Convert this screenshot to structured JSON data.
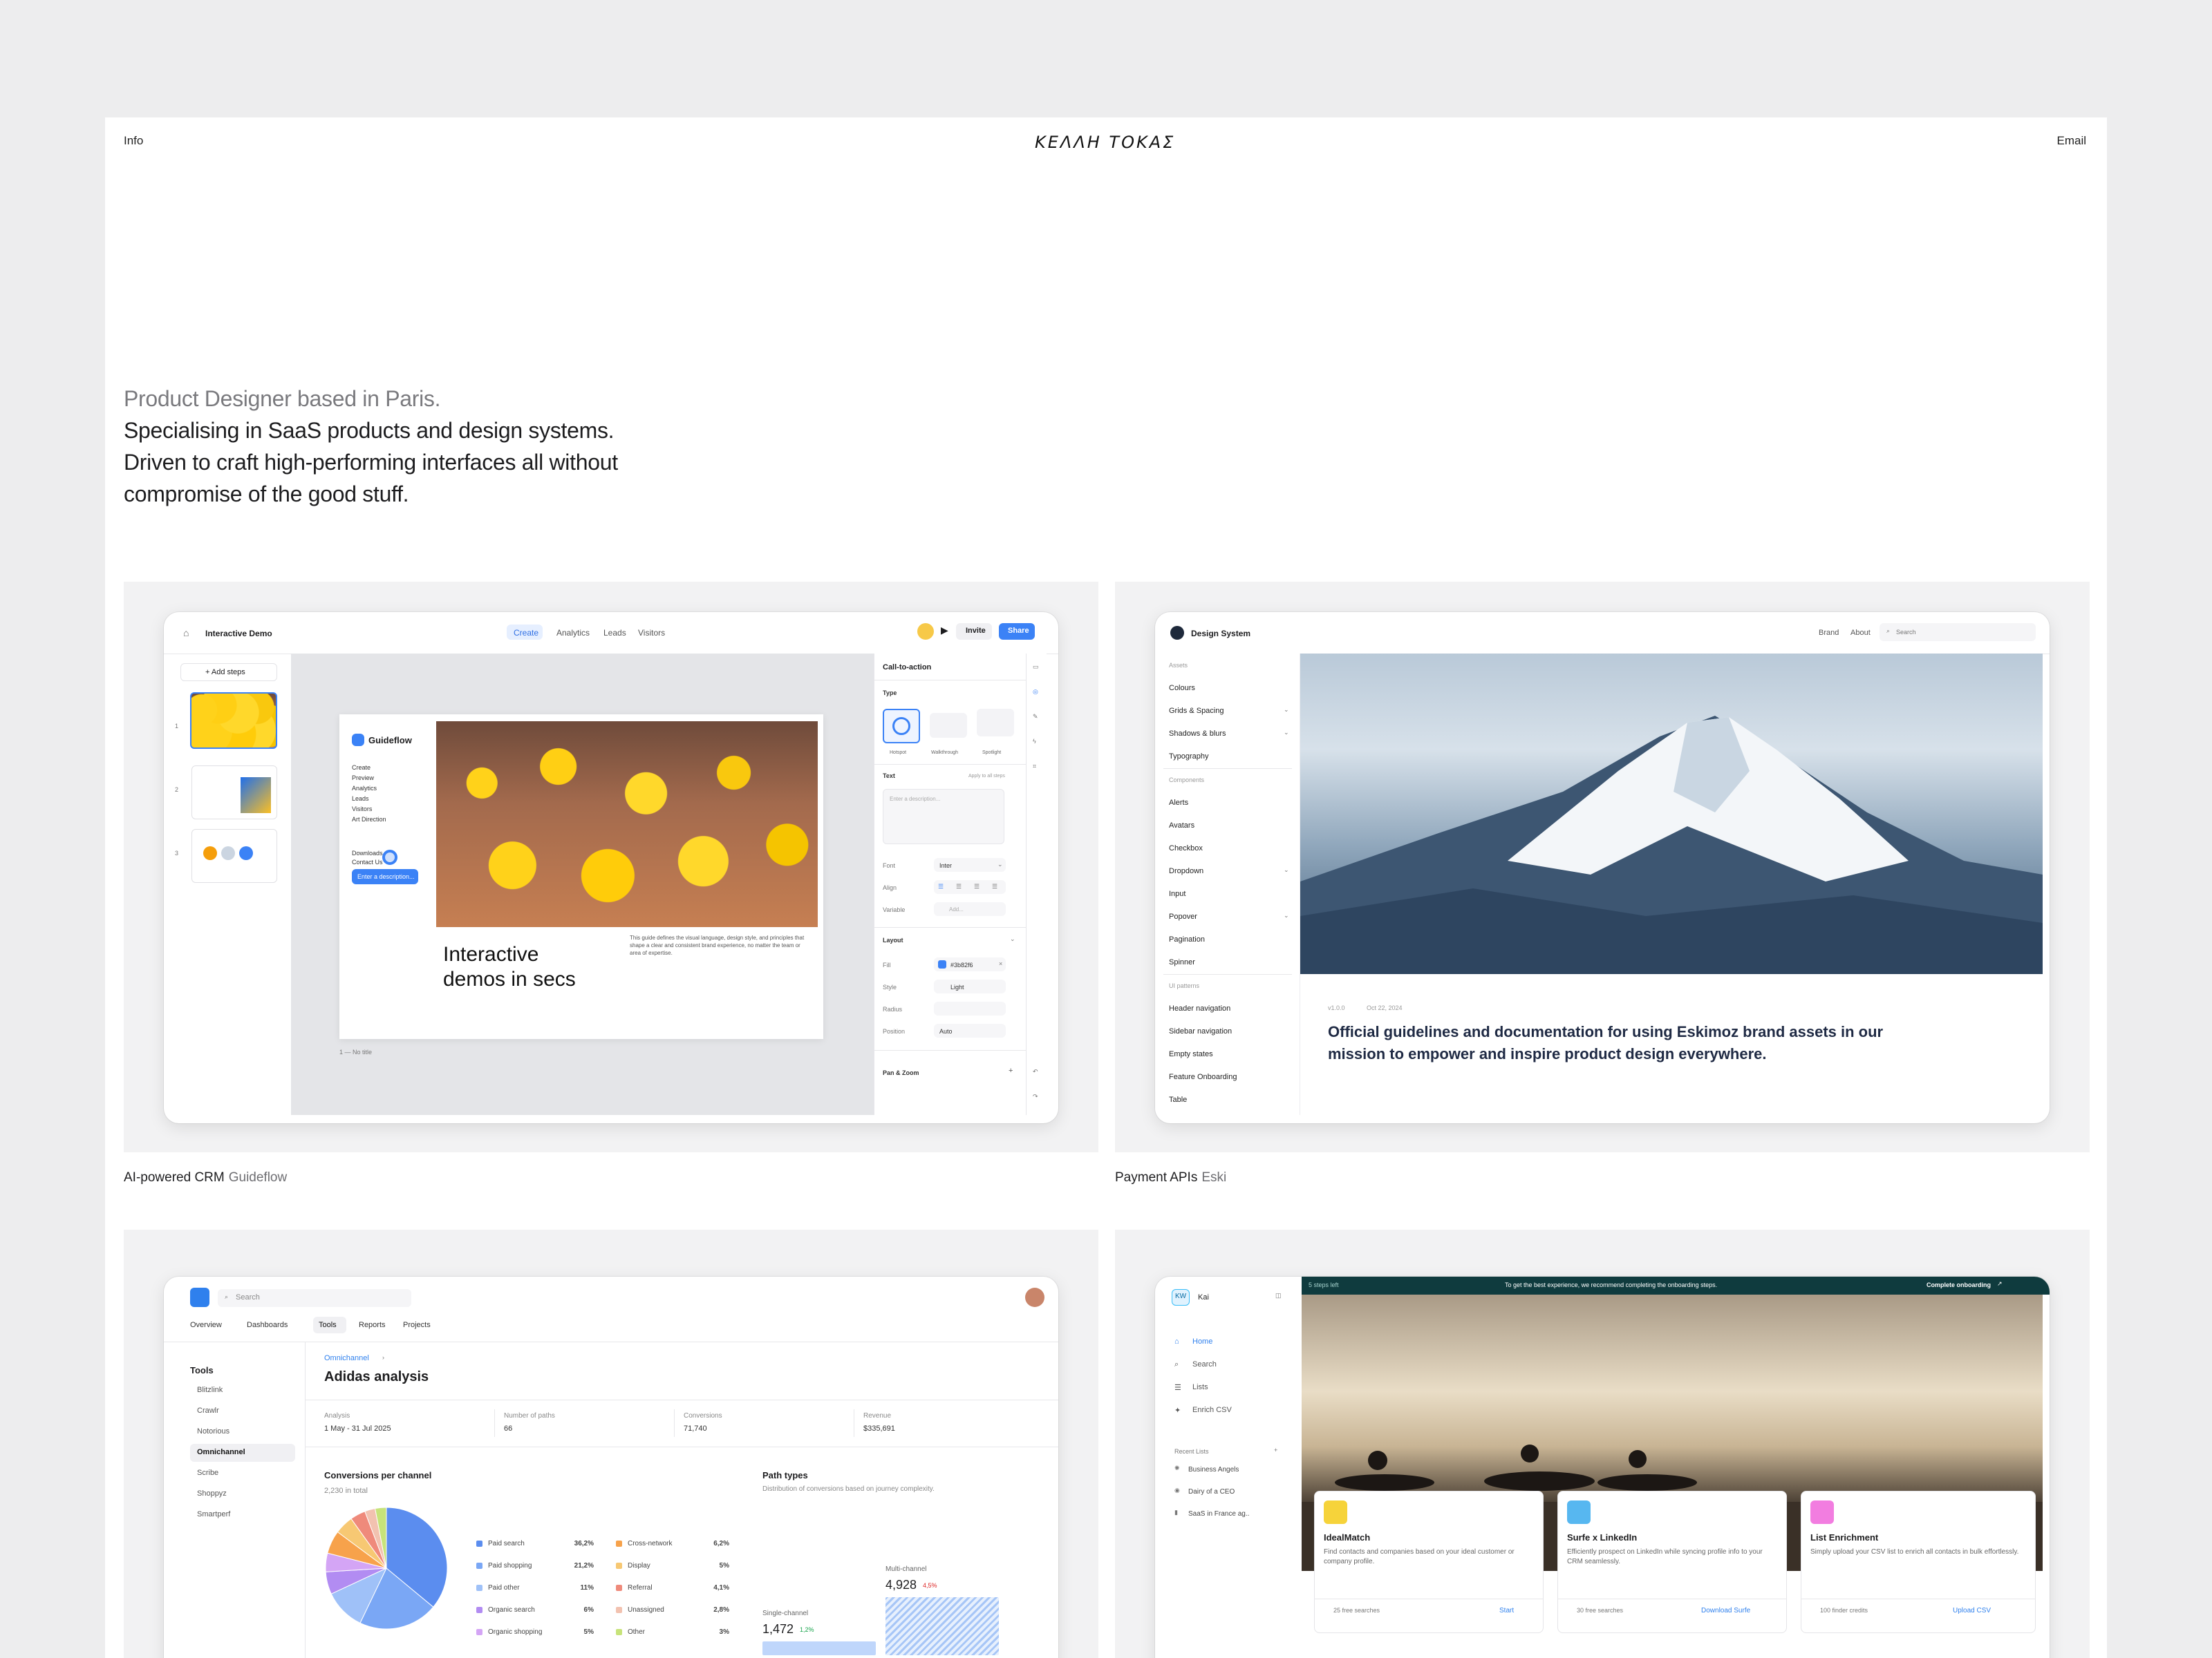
{
  "nav": {
    "left": "Info",
    "right": "Email",
    "logo_text": "ΚΕΛΛΗ ΤΟΚΑΣ"
  },
  "intro": {
    "line1": "Product Designer based in Paris.",
    "line2": "Specialising in SaaS products and design systems.",
    "line3": "Driven to craft high-performing interfaces all without",
    "line4": "compromise of the good stuff."
  },
  "projects": [
    {
      "title": "AI-powered CRM",
      "client": "Guideflow"
    },
    {
      "title": "Payment APIs",
      "client": "Eski"
    }
  ],
  "guideflow": {
    "doc_title": "Interactive Demo",
    "tabs": [
      "Create",
      "Analytics",
      "Leads",
      "Visitors"
    ],
    "invite": "Invite",
    "share": "Share",
    "add_steps": "+ Add steps",
    "steps": [
      "1",
      "2",
      "3"
    ],
    "brand": "Guideflow",
    "menu": [
      "Create",
      "Preview",
      "Analytics",
      "Leads",
      "Visitors",
      "Art Direction"
    ],
    "menu2": [
      "Downloads",
      "Contact Us"
    ],
    "tooltip": "Enter a description...",
    "hero": "Interactive\ndemos in secs",
    "body_text": "This guide defines the visual language, design style, and principles that shape a clear and consistent brand experience, no matter the team or area of expertise.",
    "footer": "1 — No title",
    "panel": {
      "heading": "Call-to-action",
      "type_label": "Type",
      "types": [
        "Hotspot",
        "Walkthrough",
        "Spotlight"
      ],
      "text_label": "Text",
      "apply_all": "Apply to all steps",
      "placeholder": "Enter a description...",
      "font_label": "Font",
      "font_value": "Inter",
      "align_label": "Align",
      "variable_label": "Variable",
      "variable_value": "Add...",
      "layout_label": "Layout",
      "fill_label": "Fill",
      "fill_value": "#3b82f6",
      "style_label": "Style",
      "style_value": "Light",
      "radius_label": "Radius",
      "position_label": "Position",
      "position_value": "Auto",
      "pan_label": "Pan & Zoom"
    }
  },
  "design_system": {
    "title": "Design System",
    "nav": [
      "Brand",
      "About"
    ],
    "search": "Search",
    "groups": [
      {
        "label": "Assets",
        "items": [
          "Colours",
          "Grids & Spacing",
          "Shadows & blurs",
          "Typography"
        ]
      },
      {
        "label": "Components",
        "items": [
          "Alerts",
          "Avatars",
          "Checkbox",
          "Dropdown",
          "Input",
          "Popover",
          "Pagination",
          "Spinner"
        ]
      },
      {
        "label": "UI patterns",
        "items": [
          "Header navigation",
          "Sidebar navigation",
          "Empty states",
          "Feature Onboarding",
          "Table"
        ]
      }
    ],
    "version": "v1.0.0",
    "date": "Oct 22, 2024",
    "headline": "Official guidelines and documentation for using Eskimoz brand assets in our mission to empower and inspire product design everywhere."
  },
  "analytics": {
    "search": "Search",
    "tabs": [
      "Overview",
      "Dashboards",
      "Tools",
      "Reports",
      "Projects"
    ],
    "tools_label": "Tools",
    "tools": [
      "Blitzlink",
      "Crawlr",
      "Notorious",
      "Omnichannel",
      "Scribe",
      "Shoppyz",
      "Smartperf"
    ],
    "breadcrumb": "Omnichannel",
    "title": "Adidas analysis",
    "stats": [
      {
        "label": "Analysis",
        "value": "1 May - 31 Jul 2025"
      },
      {
        "label": "Number of paths",
        "value": "66"
      },
      {
        "label": "Conversions",
        "value": "71,740"
      },
      {
        "label": "Revenue",
        "value": "$335,691"
      }
    ],
    "conv_title": "Conversions per channel",
    "conv_total": "2,230 in total",
    "legend_left": [
      {
        "name": "Paid search",
        "value": "36,2%",
        "color": "#5b8def"
      },
      {
        "name": "Paid shopping",
        "value": "21,2%",
        "color": "#7aa7f5"
      },
      {
        "name": "Paid other",
        "value": "11%",
        "color": "#9fc1f8"
      },
      {
        "name": "Organic search",
        "value": "6%",
        "color": "#b28cf2"
      },
      {
        "name": "Organic shopping",
        "value": "5%",
        "color": "#d4a5f5"
      }
    ],
    "legend_right": [
      {
        "name": "Cross-network",
        "value": "6,2%",
        "color": "#f7a24b"
      },
      {
        "name": "Display",
        "value": "5%",
        "color": "#f7c873"
      },
      {
        "name": "Referral",
        "value": "4,1%",
        "color": "#ef8a7b"
      },
      {
        "name": "Unassigned",
        "value": "2,8%",
        "color": "#f2c2b0"
      },
      {
        "name": "Other",
        "value": "3%",
        "color": "#c7e37a"
      }
    ],
    "path_title": "Path types",
    "path_sub": "Distribution of conversions based on journey complexity.",
    "single_label": "Single-channel",
    "single_value": "1,472",
    "single_delta": "1,2%",
    "multi_label": "Multi-channel",
    "multi_value": "4,928",
    "multi_delta": "4,5%"
  },
  "kai": {
    "name": "Kai",
    "badge": "KW",
    "banner_left": "5 steps left",
    "banner_mid": "To get the best experience, we recommend completing the onboarding steps.",
    "banner_right": "Complete onboarding",
    "nav": [
      "Home",
      "Search",
      "Lists",
      "Enrich CSV"
    ],
    "recent_label": "Recent Lists",
    "recent": [
      "Business Angels",
      "Dairy of a CEO",
      "SaaS in France ag.."
    ],
    "cards": [
      {
        "title": "IdealMatch",
        "desc": "Find contacts and companies based on your ideal customer or company profile.",
        "meta": "25 free searches",
        "cta": "Start",
        "color": "#f6d33a"
      },
      {
        "title": "Surfe x LinkedIn",
        "desc": "Efficiently prospect on LinkedIn while syncing profile info to your CRM seamlessly.",
        "meta": "30 free searches",
        "cta": "Download Surfe",
        "color": "#57b7f0"
      },
      {
        "title": "List Enrichment",
        "desc": "Simply upload your CSV list to enrich all contacts in bulk effortlessly.",
        "meta": "100 finder credits",
        "cta": "Upload CSV",
        "color": "#f27de0"
      }
    ]
  }
}
